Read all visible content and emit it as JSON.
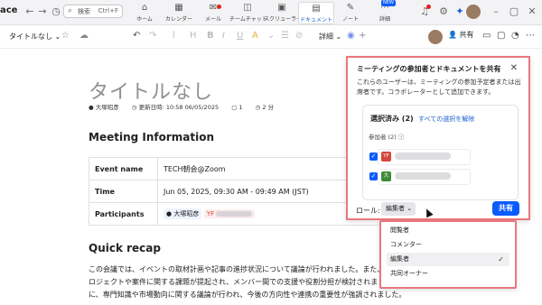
{
  "app": {
    "brand": "ace"
  },
  "search": {
    "placeholder": "検索",
    "shortcut": "Ctrl+F"
  },
  "nav": [
    {
      "label": "ホーム",
      "icon": "home-icon"
    },
    {
      "label": "カレンダー",
      "icon": "calendar-icon"
    },
    {
      "label": "メール",
      "icon": "mail-icon"
    },
    {
      "label": "チームチャット",
      "icon": "chat-icon"
    },
    {
      "label": "スクリューラー",
      "icon": "scheduler-icon"
    },
    {
      "label": "ドキュメント",
      "icon": "document-icon",
      "active": true
    },
    {
      "label": "ノート",
      "icon": "note-icon"
    },
    {
      "label": "詳細",
      "icon": "more-icon",
      "badge": "NEW"
    }
  ],
  "toolbar": {
    "doc_title": "タイトルなし",
    "detail_label": "詳細",
    "share_label": "共有"
  },
  "doc": {
    "title": "タイトルなし",
    "author": "大塚昭彦",
    "updated": "更新日時: 10:58 06/05/2025",
    "comments": "1",
    "views": "2 分",
    "meeting_heading": "Meeting Information",
    "rows": [
      {
        "key": "Event name",
        "value": "TECH朝会@Zoom"
      },
      {
        "key": "Time",
        "value": "Jun 05, 2025, 09:30 AM - 09:49 AM (JST)"
      },
      {
        "key": "Participants",
        "value": "大塚昭彦"
      }
    ],
    "recap_heading": "Quick recap",
    "recap_lines": [
      "この会議では、イベントの取材計画や記事の進捗状況について議論が行われました。また、",
      "ロジェクトや案件に関する課題が提起され、メンバー間での支援や役割分担が検討されまし",
      "に、専門知識や市場動向に関する議論が行われ、今後の方向性や連携の重要性が強調されました。"
    ]
  },
  "modal": {
    "title": "ミーティングの参加者とドキュメントを共有",
    "description": "これらのユーザーは、ミーティングの参加予定者または出席者です。コラボレーターとして追加できます。",
    "selected_label": "選択済み (2)",
    "clear_label": "すべての選択を解除",
    "participants_label": "参加者 (2)",
    "participants": [
      {
        "initials": "YF",
        "color": "#d6453d"
      },
      {
        "initials": "大",
        "color": "#3d8b37"
      }
    ],
    "role_label": "ロール:",
    "role_value": "編集者",
    "share_button": "共有"
  },
  "role_menu": {
    "options": [
      "閲覧者",
      "コメンター",
      "編集者",
      "共同オーナー"
    ],
    "selected": "編集者"
  }
}
